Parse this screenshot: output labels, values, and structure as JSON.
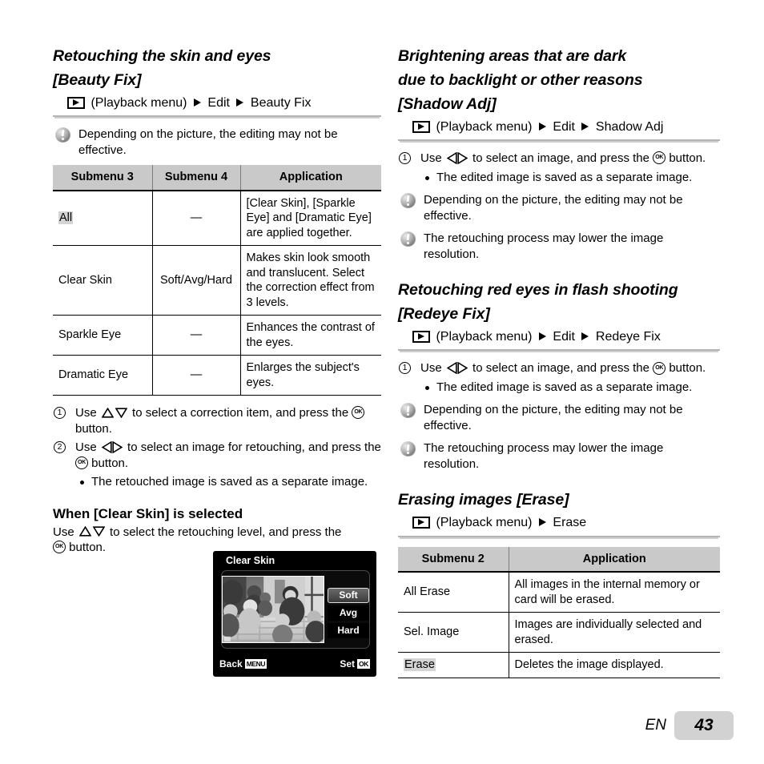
{
  "page": {
    "language_code": "EN",
    "page_number": "43"
  },
  "left_column": {
    "section1": {
      "heading_line1": "Retouching the skin and eyes",
      "heading_line2": "[Beauty Fix]",
      "breadcrumb": {
        "icon": "playback-icon",
        "menu_label": "(Playback menu)",
        "step1": "Edit",
        "step2": "Beauty Fix"
      },
      "note": "Depending on the picture, the editing may not be effective.",
      "table": {
        "headers": [
          "Submenu 3",
          "Submenu 4",
          "Application"
        ],
        "rows": [
          {
            "submenu3": "All",
            "submenu3_highlighted": true,
            "submenu4": "—",
            "application": "[Clear Skin], [Sparkle Eye] and [Dramatic Eye] are applied together."
          },
          {
            "submenu3": "Clear Skin",
            "submenu3_highlighted": false,
            "submenu4": "Soft/Avg/Hard",
            "application": "Makes skin look smooth and translucent. Select the correction effect from 3 levels."
          },
          {
            "submenu3": "Sparkle Eye",
            "submenu3_highlighted": false,
            "submenu4": "—",
            "application": "Enhances the contrast of the eyes."
          },
          {
            "submenu3": "Dramatic Eye",
            "submenu3_highlighted": false,
            "submenu4": "—",
            "application": "Enlarges the subject's eyes."
          }
        ]
      },
      "steps": {
        "step1_a": "Use",
        "step1_b": "to select a correction item, and press the",
        "step1_c": "button.",
        "step2_a": "Use",
        "step2_b": "to select an image for retouching, and press the",
        "step2_c": "button.",
        "bullet1": "The retouched image is saved as a separate image."
      }
    },
    "section2": {
      "heading": "When [Clear Skin] is selected",
      "body_a": "Use",
      "body_b": "to select the retouching level, and press the",
      "body_c": "button."
    },
    "lcd": {
      "title": "Clear Skin",
      "options": [
        "Soft",
        "Avg",
        "Hard"
      ],
      "selected_option": "Soft",
      "footer_left_label": "Back",
      "footer_left_badge": "MENU",
      "footer_right_label": "Set",
      "footer_right_badge": "OK"
    }
  },
  "right_column": {
    "section1": {
      "heading_line1": "Brightening areas that are dark",
      "heading_line2": "due to backlight or other reasons",
      "heading_line3": "[Shadow Adj]",
      "breadcrumb": {
        "icon": "playback-icon",
        "menu_label": "(Playback menu)",
        "step1": "Edit",
        "step2": "Shadow Adj"
      },
      "step1_a": "Use",
      "step1_b": "to select an image, and press the",
      "step1_c": "button.",
      "bullet1": "The edited image is saved as a separate image.",
      "note1": "Depending on the picture, the editing may not be effective.",
      "note2": "The retouching process may lower the image resolution."
    },
    "section2": {
      "heading_line1": "Retouching red eyes in flash shooting",
      "heading_line2": "[Redeye Fix]",
      "breadcrumb": {
        "icon": "playback-icon",
        "menu_label": "(Playback menu)",
        "step1": "Edit",
        "step2": "Redeye Fix"
      },
      "step1_a": "Use",
      "step1_b": "to select an image, and press the",
      "step1_c": "button.",
      "bullet1": "The edited image is saved as a separate image.",
      "note1": "Depending on the picture, the editing may not be effective.",
      "note2": "The retouching process may lower the image resolution."
    },
    "section3": {
      "heading": "Erasing images [Erase]",
      "breadcrumb": {
        "icon": "playback-icon",
        "menu_label": "(Playback menu)",
        "step1": "Erase"
      },
      "table": {
        "headers": [
          "Submenu 2",
          "Application"
        ],
        "rows": [
          {
            "submenu2": "All Erase",
            "submenu2_highlighted": false,
            "application": "All images in the internal memory or card will be erased."
          },
          {
            "submenu2": "Sel. Image",
            "submenu2_highlighted": false,
            "application": "Images are individually selected and erased."
          },
          {
            "submenu2": "Erase",
            "submenu2_highlighted": true,
            "application": "Deletes the image displayed."
          }
        ]
      }
    }
  },
  "glyphs": {
    "ok_button": "OK",
    "arrow_right": "▶",
    "dash": "—"
  }
}
